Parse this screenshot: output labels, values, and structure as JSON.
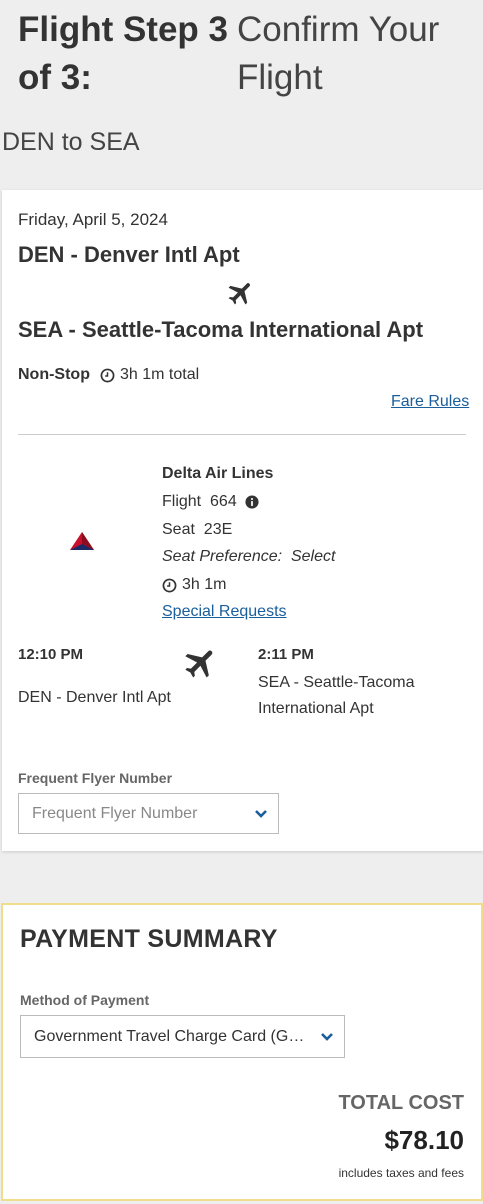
{
  "header": {
    "step_label": "Flight Step 3 of 3:",
    "title": "Confirm Your Flight",
    "route": "DEN to SEA"
  },
  "flight": {
    "date": "Friday, April 5, 2024",
    "origin": "DEN - Denver Intl Apt",
    "destination": "SEA - Seattle-Tacoma International Apt",
    "stops": "Non-Stop",
    "total_duration": "3h 1m total",
    "fare_rules_link": "Fare Rules",
    "segment": {
      "airline": "Delta Air Lines",
      "flight_number": "Flight  664",
      "seat": "Seat  23E",
      "seat_preference": "Seat Preference:  Select",
      "duration": "3h 1m",
      "special_requests_link": "Special Requests",
      "depart_time": "12:10 PM",
      "depart_airport": "DEN - Denver Intl Apt",
      "arrive_time": "2:11 PM",
      "arrive_airport": "SEA - Seattle-Tacoma International Apt"
    },
    "frequent_flyer": {
      "label": "Frequent Flyer Number",
      "placeholder": "Frequent Flyer Number"
    }
  },
  "payment": {
    "title": "PAYMENT SUMMARY",
    "method_label": "Method of Payment",
    "method_value": "Government Travel Charge Card (GTCC)",
    "total_label": "TOTAL COST",
    "total_value": "$78.10",
    "total_note": "includes taxes and fees"
  },
  "icons": {
    "plane": "airplane-icon",
    "clock": "clock-icon",
    "info": "info-icon",
    "chevron": "chevron-down-icon",
    "airline_logo": "delta-logo"
  },
  "colors": {
    "link": "#1a5e9c",
    "chevron": "#1a5e9c",
    "payment_border": "#f1dc8a",
    "page_bg": "#eeeeee"
  }
}
